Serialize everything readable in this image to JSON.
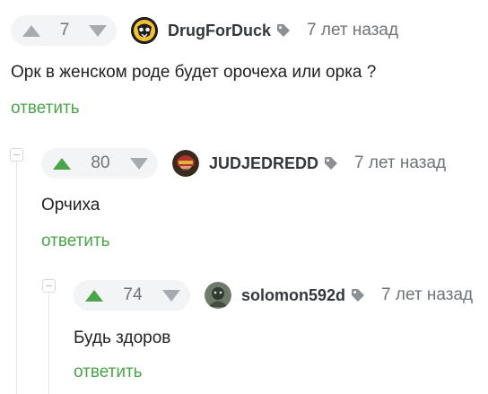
{
  "comments": [
    {
      "rating": "7",
      "username": "DrugForDuck",
      "time": "7 лет назад",
      "text": "Орк в  женском роде будет орочеха или орка ?",
      "reply_label": "ответить",
      "upvote_icon": "arrow-up-icon",
      "downvote_icon": "arrow-down-icon",
      "upvote_active": false
    },
    {
      "rating": "80",
      "username": "JUDJEDREDD",
      "time": "7 лет назад",
      "text": "Орчиха",
      "reply_label": "ответить",
      "upvote_icon": "arrow-up-icon",
      "downvote_icon": "arrow-down-icon",
      "upvote_active": true
    },
    {
      "rating": "74",
      "username": "solomon592d",
      "time": "7 лет назад",
      "text": "Будь здоров",
      "reply_label": "ответить",
      "upvote_icon": "arrow-up-icon",
      "downvote_icon": "arrow-down-icon",
      "upvote_active": true
    }
  ],
  "colors": {
    "upvote_active": "#4aa54a",
    "arrow_inactive": "#a5abb0",
    "reply_link": "#4aa54a",
    "pill_background": "#f3f4f5"
  }
}
